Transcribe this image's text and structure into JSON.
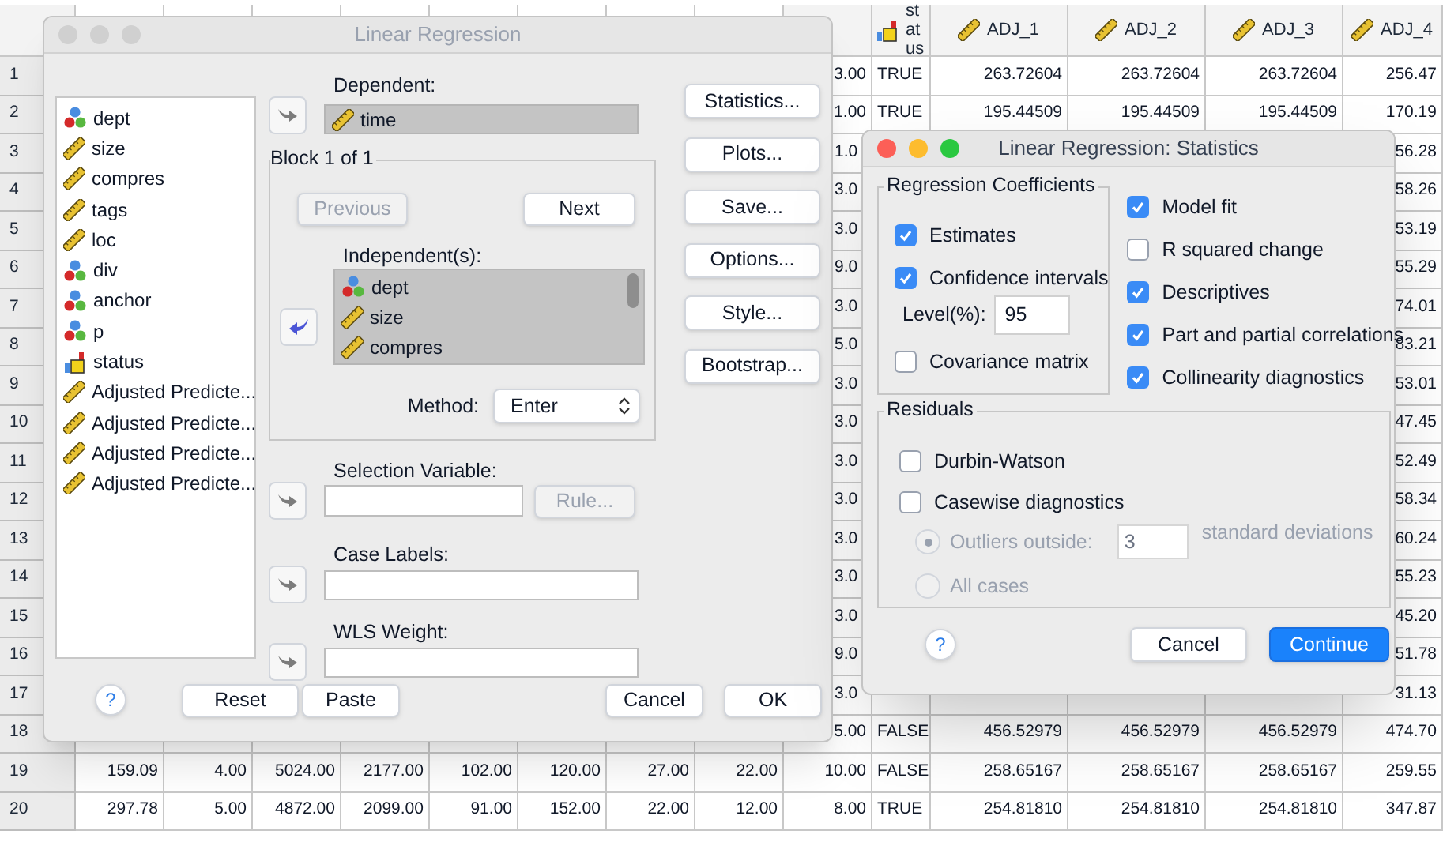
{
  "data_grid": {
    "columns": [
      {
        "label": "status",
        "kind": "string"
      },
      {
        "label": "ADJ_1",
        "kind": "scale"
      },
      {
        "label": "ADJ_2",
        "kind": "scale"
      },
      {
        "label": "ADJ_3",
        "kind": "scale"
      },
      {
        "label": "ADJ_4",
        "kind": "scale"
      }
    ],
    "rows": [
      {
        "number": "1",
        "col_9": "3.00",
        "status": "TRUE",
        "adj": [
          "263.72604",
          "263.72604",
          "263.72604",
          "256.47"
        ]
      },
      {
        "number": "2",
        "col_9": "1.00",
        "status": "TRUE",
        "adj": [
          "195.44509",
          "195.44509",
          "195.44509",
          "170.19"
        ]
      },
      {
        "number": "3",
        "col_9": "1.0",
        "adj_4": "56.28"
      },
      {
        "number": "4",
        "col_9": "3.0",
        "adj_4": "58.26"
      },
      {
        "number": "5",
        "col_9": "3.0",
        "adj_4": "53.19"
      },
      {
        "number": "6",
        "col_9": "9.0",
        "adj_4": "55.29"
      },
      {
        "number": "7",
        "col_9": "3.0",
        "adj_4": "74.01"
      },
      {
        "number": "8",
        "col_9": "5.0",
        "adj_4": "83.21"
      },
      {
        "number": "9",
        "col_9": "3.0",
        "adj_4": "53.01"
      },
      {
        "number": "10",
        "col_9": "3.0",
        "adj_4": "47.45"
      },
      {
        "number": "11",
        "col_9": "3.0",
        "adj_4": "52.49"
      },
      {
        "number": "12",
        "col_9": "3.0",
        "adj_4": "58.34"
      },
      {
        "number": "13",
        "col_9": "3.0",
        "adj_4": "60.24"
      },
      {
        "number": "14",
        "col_9": "3.0",
        "adj_4": "55.23"
      },
      {
        "number": "15",
        "col_9": "3.0",
        "adj_4": "45.20"
      },
      {
        "number": "16",
        "col_9": "9.0",
        "adj_4": "51.78"
      },
      {
        "number": "17",
        "col_9": "3.0",
        "adj_4": "31.13"
      },
      {
        "number": "18",
        "col_9": "5.00",
        "status": "FALSE",
        "adj": [
          "456.52979",
          "456.52979",
          "456.52979",
          "474.70"
        ]
      },
      {
        "number": "19",
        "values": [
          "159.09",
          "4.00",
          "5024.00",
          "2177.00",
          "102.00",
          "120.00",
          "27.00",
          "22.00"
        ],
        "col_9": "10.00",
        "status": "FALSE",
        "adj": [
          "258.65167",
          "258.65167",
          "258.65167",
          "259.55"
        ]
      },
      {
        "number": "20",
        "values": [
          "297.78",
          "5.00",
          "4872.00",
          "2099.00",
          "91.00",
          "152.00",
          "22.00",
          "12.00"
        ],
        "col_9": "8.00",
        "status": "TRUE",
        "adj": [
          "254.81810",
          "254.81810",
          "254.81810",
          "347.87"
        ]
      }
    ]
  },
  "regression_dialog": {
    "title": "Linear Regression",
    "active": false,
    "variables": [
      {
        "name": "dept",
        "kind": "nominal"
      },
      {
        "name": "size",
        "kind": "scale"
      },
      {
        "name": "compres",
        "kind": "scale"
      },
      {
        "name": "tags",
        "kind": "scale"
      },
      {
        "name": "loc",
        "kind": "scale"
      },
      {
        "name": "div",
        "kind": "nominal"
      },
      {
        "name": "anchor",
        "kind": "nominal"
      },
      {
        "name": "p",
        "kind": "nominal"
      },
      {
        "name": "status",
        "kind": "string"
      },
      {
        "name": "Adjusted Predicte...",
        "kind": "scale"
      },
      {
        "name": "Adjusted Predicte...",
        "kind": "scale"
      },
      {
        "name": "Adjusted Predicte...",
        "kind": "scale"
      },
      {
        "name": "Adjusted Predicte...",
        "kind": "scale"
      }
    ],
    "dependent": {
      "label": "Dependent:",
      "variable": {
        "name": "time",
        "kind": "scale"
      }
    },
    "block": {
      "title": "Block 1 of 1",
      "previous": {
        "label": "Previous",
        "disabled": true
      },
      "next": {
        "label": "Next",
        "disabled": false
      }
    },
    "independents": {
      "label": "Independent(s):",
      "variables": [
        {
          "name": "dept",
          "kind": "nominal"
        },
        {
          "name": "size",
          "kind": "scale"
        },
        {
          "name": "compres",
          "kind": "scale"
        }
      ]
    },
    "method": {
      "label": "Method:",
      "value": "Enter"
    },
    "selection_variable": {
      "label": "Selection Variable:",
      "rule": {
        "label": "Rule...",
        "disabled": true
      }
    },
    "case_labels": {
      "label": "Case Labels:"
    },
    "wls_weight": {
      "label": "WLS Weight:"
    },
    "side_buttons": [
      "Statistics...",
      "Plots...",
      "Save...",
      "Options...",
      "Style...",
      "Bootstrap..."
    ],
    "help": "?",
    "footer_left": [
      "Reset",
      "Paste"
    ],
    "footer_right": [
      "Cancel",
      "OK"
    ]
  },
  "statistics_dialog": {
    "title": "Linear Regression: Statistics",
    "active": true,
    "regression_coefficients": {
      "title": "Regression Coefficients",
      "options": [
        {
          "label": "Estimates",
          "checked": true
        },
        {
          "label": "Confidence intervals",
          "checked": true
        }
      ],
      "level": {
        "label": "Level(%):",
        "value": "95"
      },
      "covariance": {
        "label": "Covariance matrix",
        "checked": false
      }
    },
    "options": [
      {
        "label": "Model fit",
        "checked": true
      },
      {
        "label": "R squared change",
        "checked": false
      },
      {
        "label": "Descriptives",
        "checked": true
      },
      {
        "label": "Part and partial correlations",
        "checked": true
      },
      {
        "label": "Collinearity diagnostics",
        "checked": true
      }
    ],
    "residuals": {
      "title": "Residuals",
      "options": [
        {
          "label": "Durbin-Watson",
          "checked": false
        },
        {
          "label": "Casewise diagnostics",
          "checked": false
        }
      ],
      "radios": [
        {
          "label": "Outliers outside:",
          "selected": true,
          "disabled": true
        },
        {
          "label": "All cases",
          "selected": false,
          "disabled": true
        }
      ],
      "outlier_sd": {
        "value": "3",
        "unit": "standard deviations"
      }
    },
    "help": "?",
    "buttons": [
      {
        "label": "Cancel",
        "primary": false
      },
      {
        "label": "Continue",
        "primary": true
      }
    ]
  }
}
